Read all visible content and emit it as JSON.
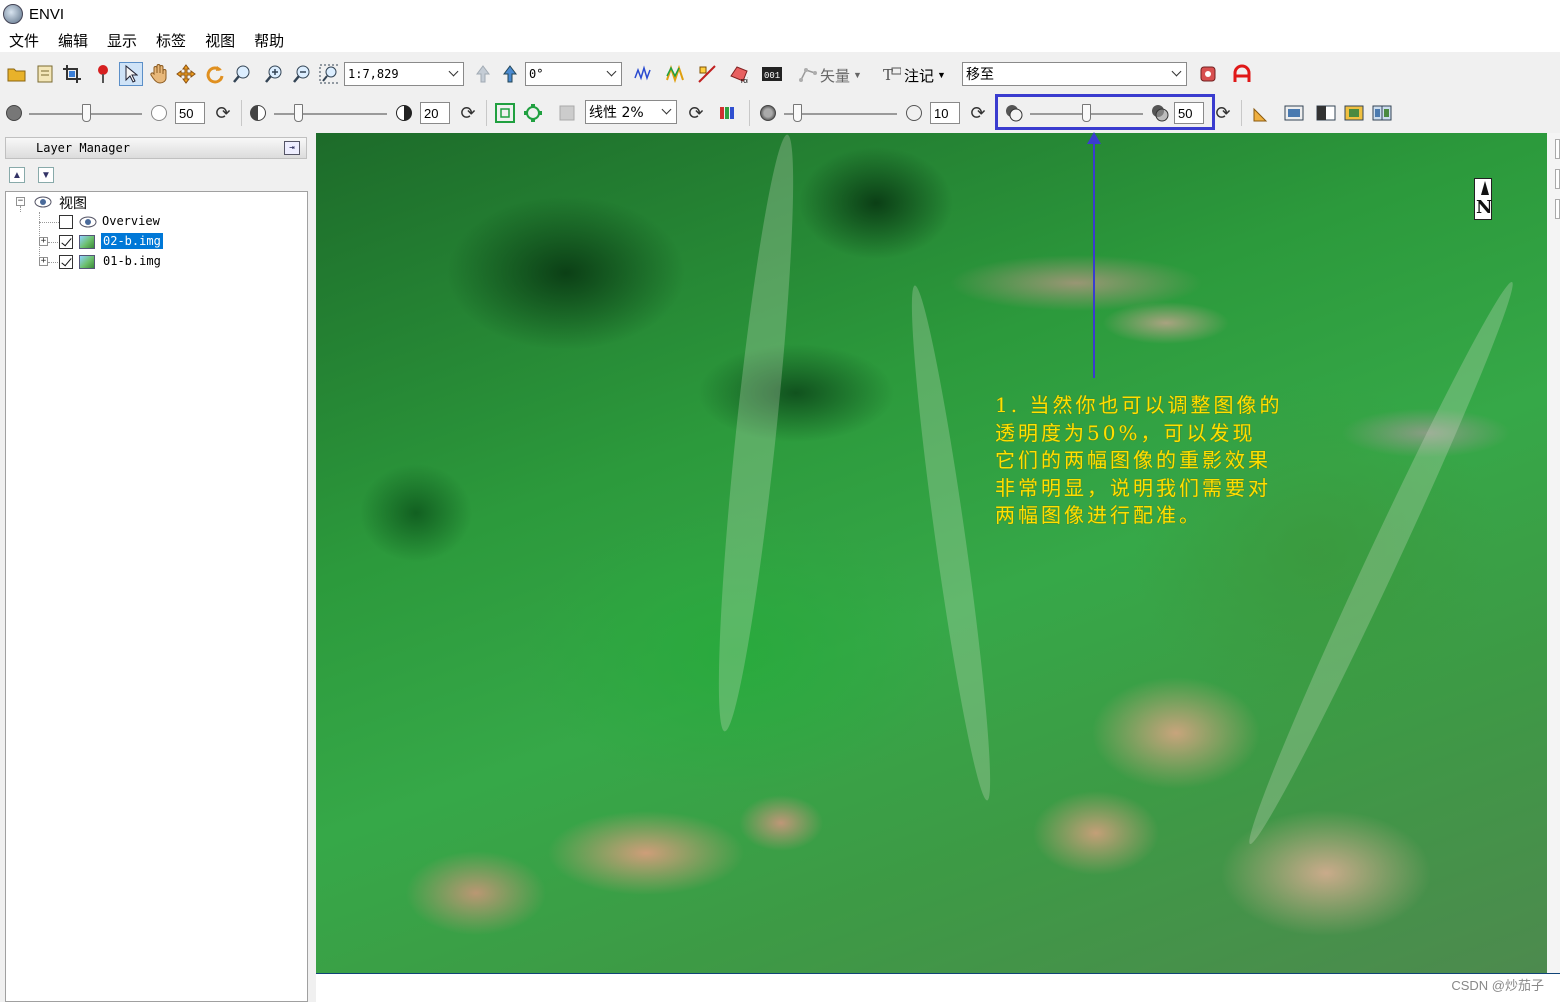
{
  "window": {
    "title": "ENVI"
  },
  "menu": [
    "文件",
    "编辑",
    "显示",
    "标签",
    "视图",
    "帮助"
  ],
  "toolbar1": {
    "scale_value": "1:7,829",
    "rotation_value": "0°",
    "vector_label": "矢量",
    "annotation_label": "注记",
    "goto_value": "移至"
  },
  "toolbar2": {
    "brightness_value": "50",
    "contrast_value": "20",
    "stretch_value": "线性 2%",
    "sharpen_value": "10",
    "transparency_value": "50",
    "transparency_slider_level": 0.5,
    "brightness_slider_level": 0.5,
    "contrast_slider_level": 0.2,
    "sharpen_slider_level": 0.1
  },
  "layer_manager": {
    "title": "Layer Manager",
    "root_label": "视图",
    "layers": [
      {
        "name": "Overview",
        "checked": false,
        "selected": false
      },
      {
        "name": "02-b.img",
        "checked": true,
        "selected": true
      },
      {
        "name": "01-b.img",
        "checked": true,
        "selected": false
      }
    ]
  },
  "annotation": {
    "lines": [
      "1. 当然你也可以调整图像的",
      "透明度为50%，可以发现",
      "它们的两幅图像的重影效果",
      "非常明显，说明我们需要对",
      "两幅图像进行配准。"
    ],
    "color": "#ffe000",
    "box_color": "#3a3ccf"
  },
  "watermark": "CSDN @炒茄子",
  "colors": {
    "accent": "#3a3ccf",
    "selection": "#0078d7"
  }
}
